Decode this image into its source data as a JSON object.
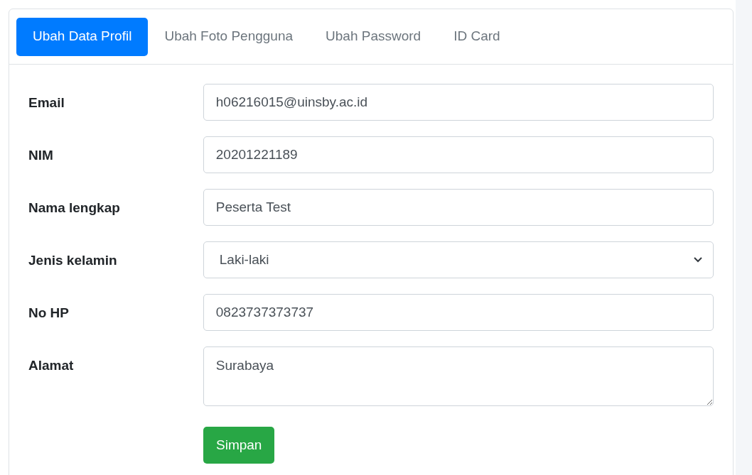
{
  "tabs": [
    {
      "label": "Ubah Data Profil",
      "selected": true
    },
    {
      "label": "Ubah Foto Pengguna",
      "selected": false
    },
    {
      "label": "Ubah Password",
      "selected": false
    },
    {
      "label": "ID Card",
      "selected": false
    }
  ],
  "fields": [
    {
      "label": "Email",
      "kind": "input",
      "value": "h06216015@uinsby.ac.id"
    },
    {
      "label": "NIM",
      "kind": "input",
      "value": "20201221189"
    },
    {
      "label": "Nama lengkap",
      "kind": "input",
      "value": "Peserta Test"
    },
    {
      "label": "Jenis kelamin",
      "kind": "select",
      "value": "Laki-laki"
    },
    {
      "label": "No HP",
      "kind": "input",
      "value": "0823737373737"
    },
    {
      "label": "Alamat",
      "kind": "textarea",
      "value": "Surabaya"
    }
  ],
  "submit": "Simpan"
}
